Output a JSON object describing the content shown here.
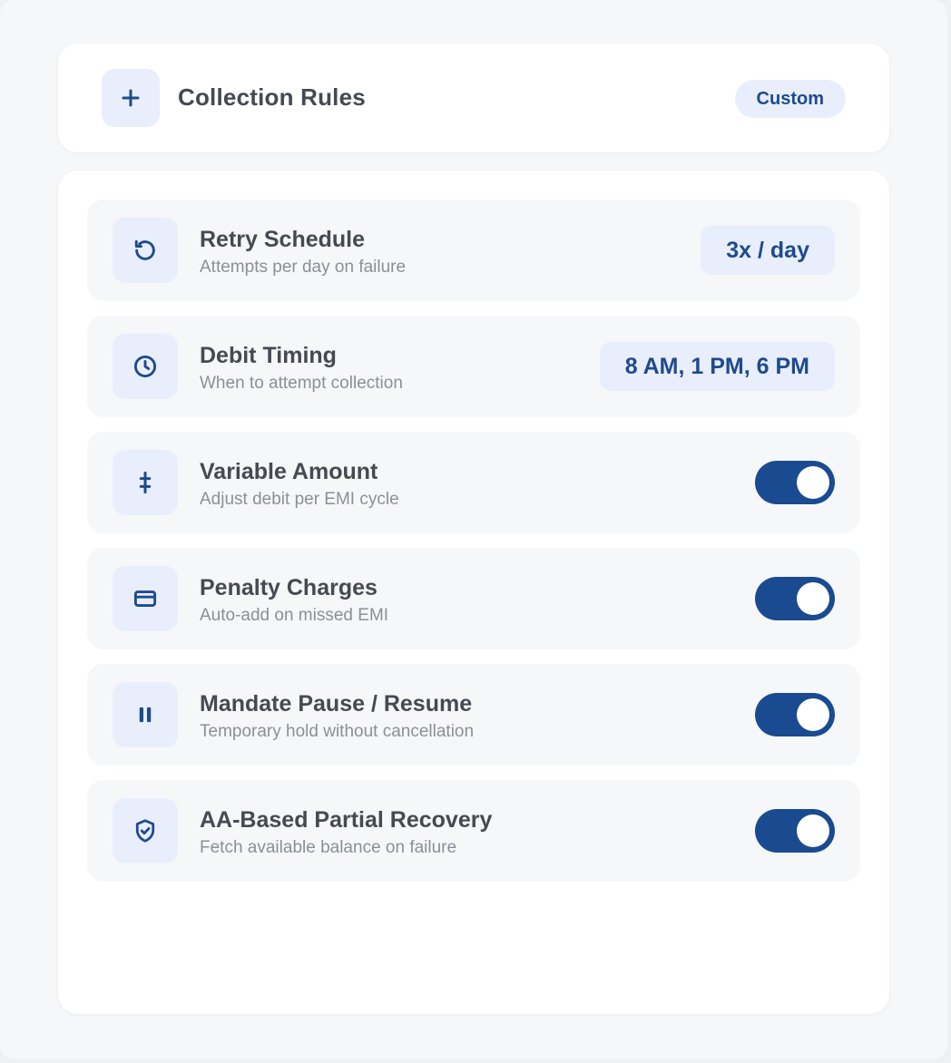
{
  "header": {
    "title": "Collection Rules",
    "icon": "plus-icon",
    "badge": "Custom"
  },
  "rules": [
    {
      "icon": "refresh-icon",
      "title": "Retry Schedule",
      "subtitle": "Attempts per day on failure",
      "control": "value",
      "value": "3x / day"
    },
    {
      "icon": "clock-icon",
      "title": "Debit Timing",
      "subtitle": "When to attempt collection",
      "control": "value",
      "value": "8 AM, 1 PM, 6 PM"
    },
    {
      "icon": "double-dagger-icon",
      "title": "Variable Amount",
      "subtitle": "Adjust debit per EMI cycle",
      "control": "toggle",
      "enabled": true
    },
    {
      "icon": "credit-card-icon",
      "title": "Penalty Charges",
      "subtitle": "Auto-add on missed EMI",
      "control": "toggle",
      "enabled": true
    },
    {
      "icon": "pause-icon",
      "title": "Mandate Pause / Resume",
      "subtitle": "Temporary hold without cancellation",
      "control": "toggle",
      "enabled": true
    },
    {
      "icon": "shield-check-icon",
      "title": "AA-Based Partial Recovery",
      "subtitle": "Fetch available balance on failure",
      "control": "toggle",
      "enabled": true
    }
  ],
  "colors": {
    "accent": "#1a4b91",
    "accent_text": "#1f4a8e",
    "chip_bg": "#e8eefb",
    "title_text": "#454a52",
    "subtitle_text": "#8a9098"
  }
}
